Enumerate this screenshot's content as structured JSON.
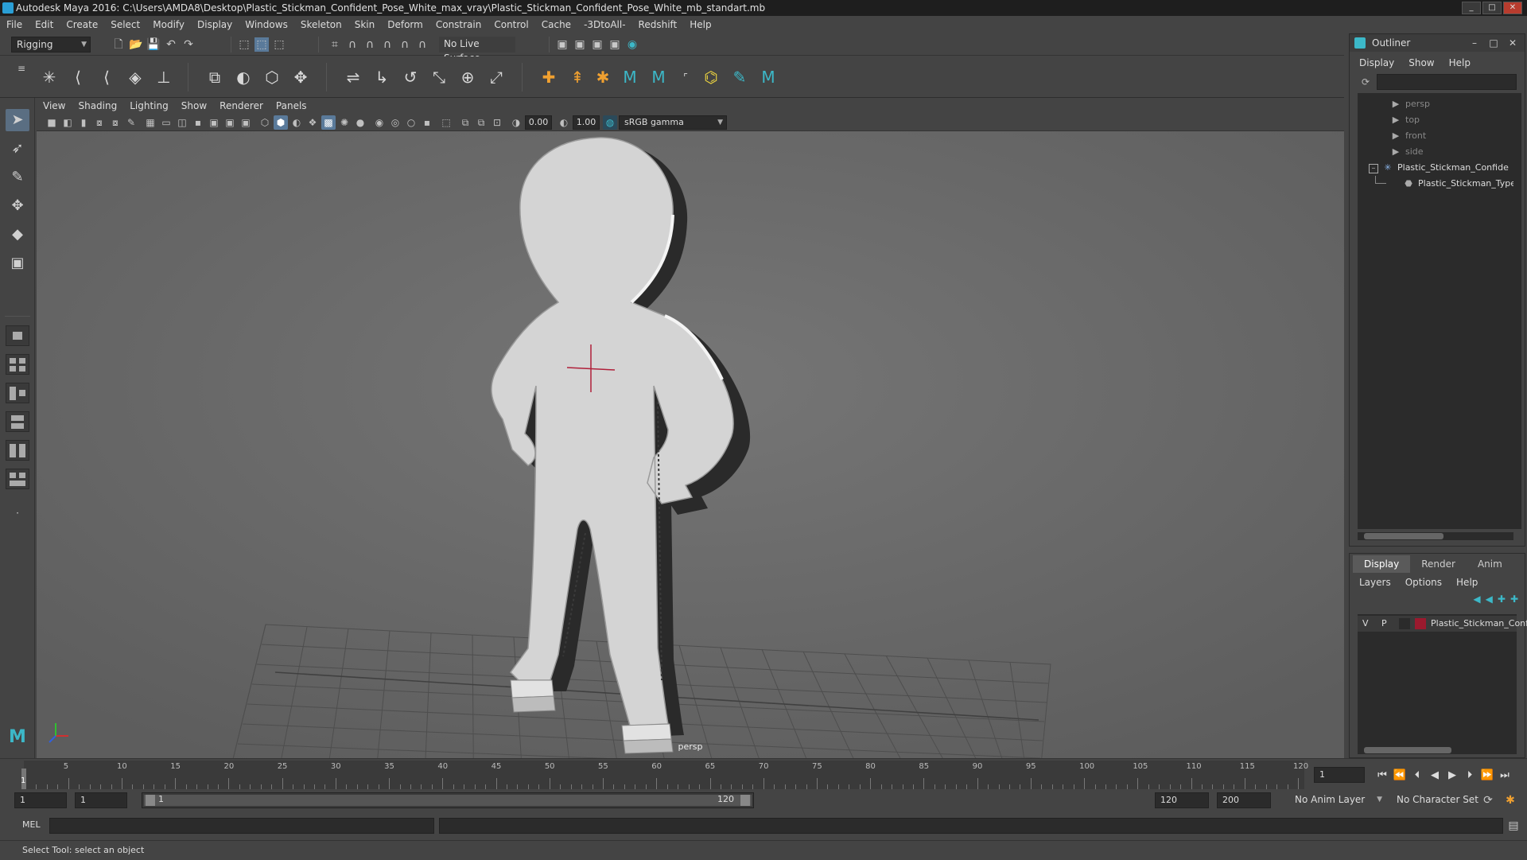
{
  "window": {
    "title": "Autodesk Maya 2016: C:\\Users\\AMDA8\\Desktop\\Plastic_Stickman_Confident_Pose_White_max_vray\\Plastic_Stickman_Confident_Pose_White_mb_standart.mb"
  },
  "menubar": {
    "items": [
      "File",
      "Edit",
      "Create",
      "Select",
      "Modify",
      "Display",
      "Windows",
      "Skeleton",
      "Skin",
      "Deform",
      "Constrain",
      "Control",
      "Cache",
      "-3DtoAll-",
      "Redshift",
      "Help"
    ]
  },
  "shelf": {
    "mode": "Rigging",
    "live_surface": "No Live Surface"
  },
  "viewport": {
    "menus": [
      "View",
      "Shading",
      "Lighting",
      "Show",
      "Renderer",
      "Panels"
    ],
    "exposure": "0.00",
    "gamma": "1.00",
    "color_space": "sRGB gamma",
    "camera_label": "persp"
  },
  "outliner": {
    "title": "Outliner",
    "menus": [
      "Display",
      "Show",
      "Help"
    ],
    "items": [
      {
        "label": "persp",
        "icon": "camera-icon"
      },
      {
        "label": "top",
        "icon": "camera-icon"
      },
      {
        "label": "front",
        "icon": "camera-icon"
      },
      {
        "label": "side",
        "icon": "camera-icon"
      },
      {
        "label": "Plastic_Stickman_Confide",
        "icon": "joint-icon"
      },
      {
        "label": "Plastic_Stickman_Type",
        "icon": "mesh-icon"
      }
    ]
  },
  "layers": {
    "tabs": [
      "Display",
      "Render",
      "Anim"
    ],
    "active_tab": "Display",
    "menus": [
      "Layers",
      "Options",
      "Help"
    ],
    "rows": [
      {
        "v": "V",
        "p": "P",
        "color": "#9b1a2e",
        "name": "Plastic_Stickman_Conf"
      }
    ]
  },
  "timeline": {
    "tick_labels": [
      "5",
      "10",
      "15",
      "20",
      "25",
      "30",
      "35",
      "40",
      "45",
      "50",
      "55",
      "60",
      "65",
      "70",
      "75",
      "80",
      "85",
      "90",
      "95",
      "100",
      "105",
      "110",
      "115",
      "120"
    ],
    "current_frame_marker": "1",
    "current_frame": "1"
  },
  "range": {
    "start": "1",
    "playback_start": "1",
    "slider_start": "1",
    "slider_end": "120",
    "playback_end": "120",
    "end": "200",
    "anim_layer": "No Anim Layer",
    "character_set": "No Character Set"
  },
  "command": {
    "lang": "MEL"
  },
  "help_line": "Select Tool: select an object",
  "colors": {
    "accent": "#5a6e82",
    "layer_color": "#9b1a2e"
  }
}
